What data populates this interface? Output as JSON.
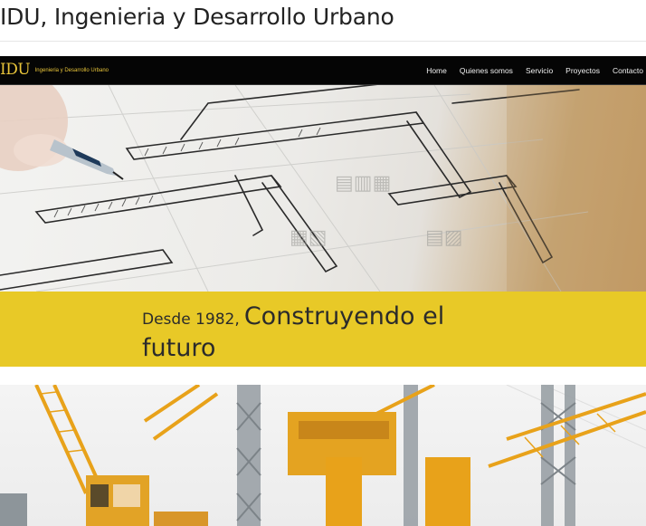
{
  "page": {
    "title": "IDU, Ingenieria y Desarrollo Urbano"
  },
  "navbar": {
    "brand_main": "IDU",
    "brand_sub": "Ingenieria y Desarrollo Urbano",
    "items": [
      {
        "label": "Home"
      },
      {
        "label": "Quienes somos"
      },
      {
        "label": "Servicio"
      },
      {
        "label": "Proyectos"
      },
      {
        "label": "Contacto"
      }
    ]
  },
  "hero": {
    "image_1": "architectural-sketch-photo",
    "image_2": "construction-cranes-photo"
  },
  "tagline": {
    "small": "Desde 1982,",
    "big_line1": "Construyendo el",
    "big_line2": "futuro"
  },
  "colors": {
    "brand_gold": "#e9c53a",
    "band_yellow": "#e8c927",
    "navbar_bg": "#050505",
    "crane_yellow": "#e8a21a"
  }
}
